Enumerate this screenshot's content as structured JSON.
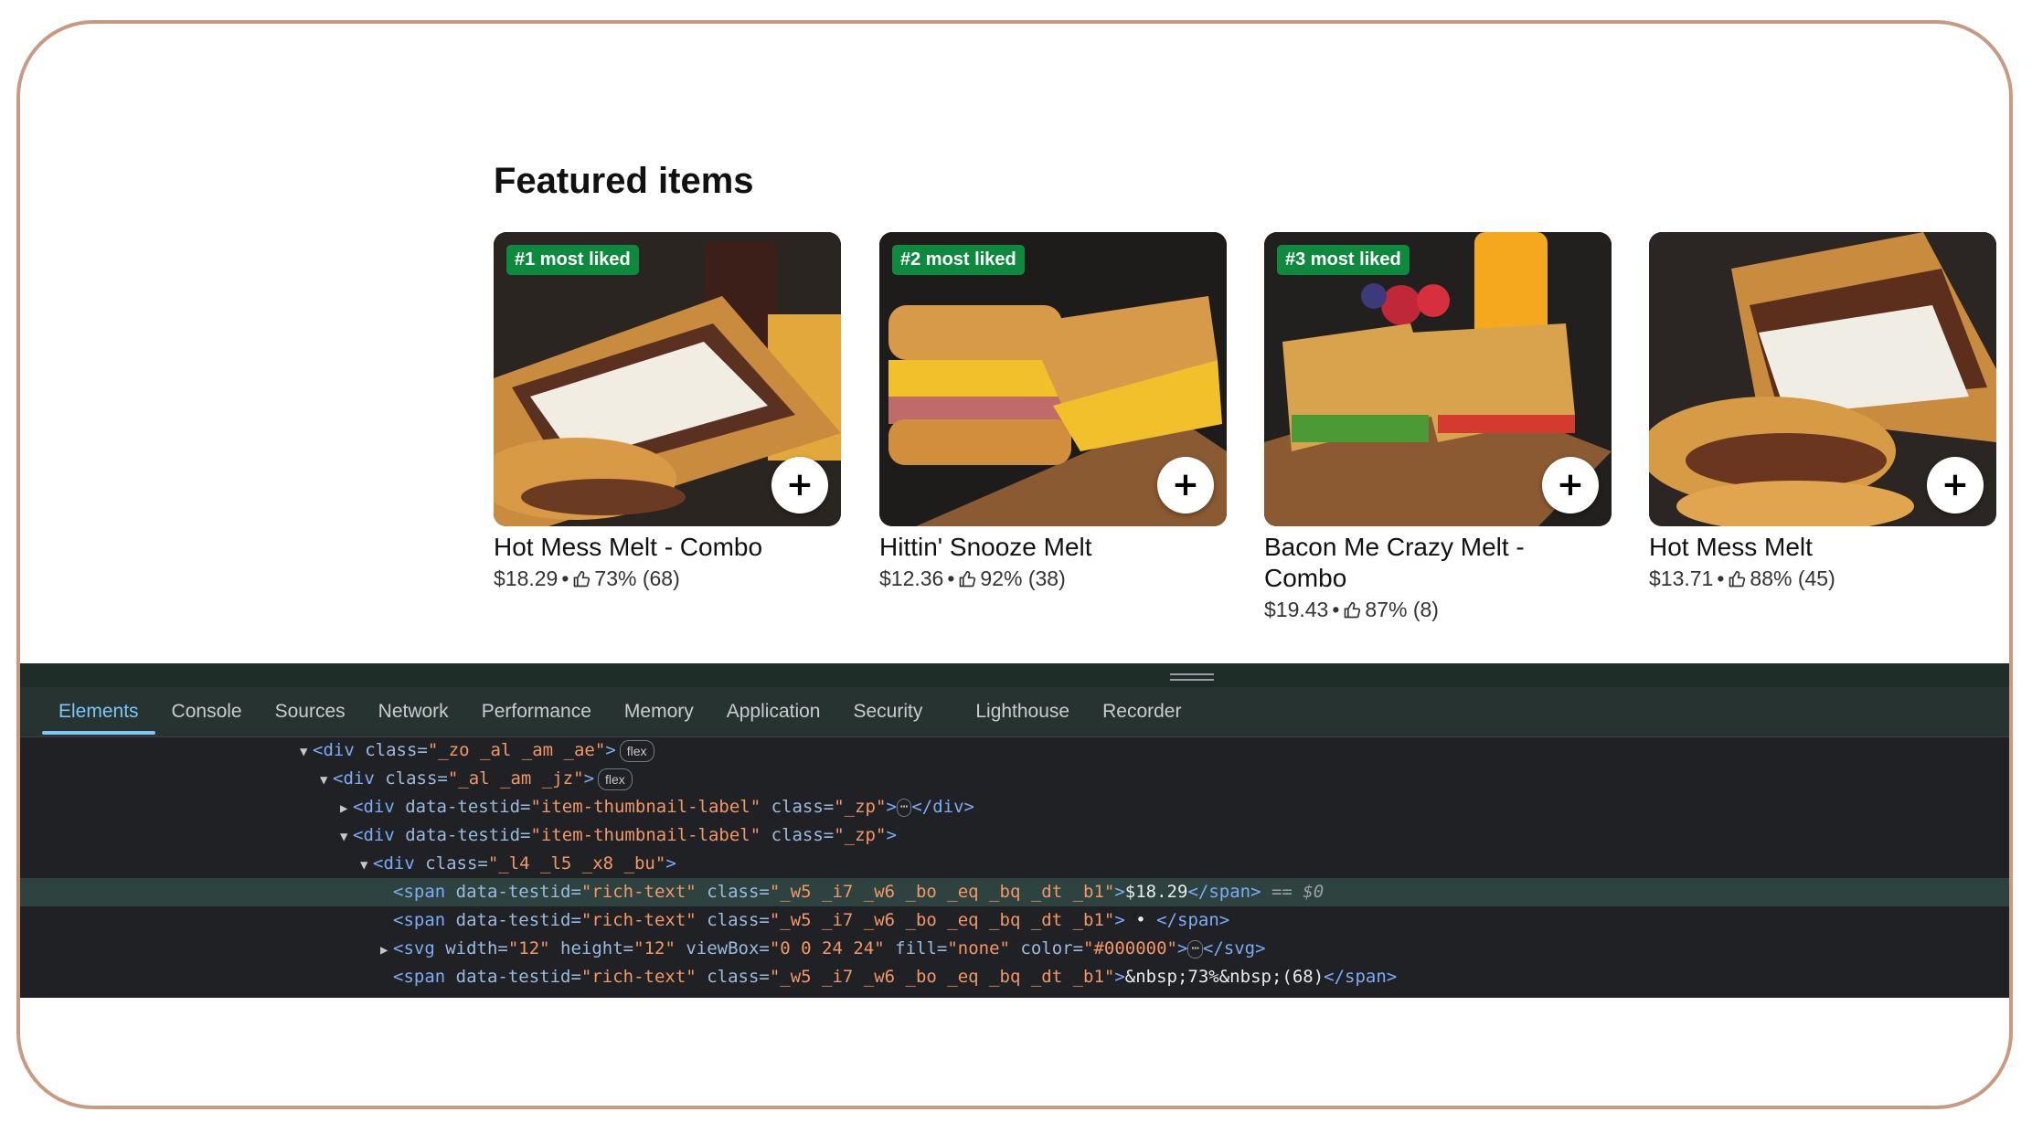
{
  "section": {
    "title": "Featured items"
  },
  "items": [
    {
      "badge": "#1 most liked",
      "name": "Hot Mess Melt - Combo",
      "price": "$18.29",
      "sep": "•",
      "rating": "73% (68)",
      "add": "+"
    },
    {
      "badge": "#2 most liked",
      "name": "Hittin' Snooze Melt",
      "price": "$12.36",
      "sep": "•",
      "rating": "92% (38)",
      "add": "+"
    },
    {
      "badge": "#3 most liked",
      "name": "Bacon Me Crazy Melt - Combo",
      "price": "$19.43",
      "sep": "•",
      "rating": "87% (8)",
      "add": "+"
    },
    {
      "badge": "",
      "name": "Hot Mess Melt",
      "price": "$13.71",
      "sep": "•",
      "rating": "88% (45)",
      "add": "+"
    }
  ],
  "devtools": {
    "tabs": [
      "Elements",
      "Console",
      "Sources",
      "Network",
      "Performance",
      "Memory",
      "Application",
      "Security",
      "Lighthouse",
      "Recorder"
    ],
    "active_tab": "Elements",
    "lines": {
      "l1_tag": "<div",
      "l1_attr": " class=",
      "l1_val": "\"_zo _al _am _ae\"",
      "l1_close": ">",
      "l1_pill": "flex",
      "l2_tag": "<div",
      "l2_attr": " class=",
      "l2_val": "\"_al _am _jz\"",
      "l2_close": ">",
      "l2_pill": "flex",
      "l3_tag": "<div",
      "l3_attr1": " data-testid=",
      "l3_val1": "\"item-thumbnail-label\"",
      "l3_attr2": " class=",
      "l3_val2": "\"_zp\"",
      "l3_close": ">",
      "l3_end": "</div>",
      "l4_tag": "<div",
      "l4_attr1": " data-testid=",
      "l4_val1": "\"item-thumbnail-label\"",
      "l4_attr2": " class=",
      "l4_val2": "\"_zp\"",
      "l4_close": ">",
      "l5_tag": "<div",
      "l5_attr": " class=",
      "l5_val": "\"_l4 _l5 _x8 _bu\"",
      "l5_close": ">",
      "l6_tag": "<span",
      "l6_attr1": " data-testid=",
      "l6_val1": "\"rich-text\"",
      "l6_attr2": " class=",
      "l6_val2": "\"_w5 _i7 _w6 _bo _eq _bq _dt _b1\"",
      "l6_close": ">",
      "l6_text": "$18.29",
      "l6_end": "</span>",
      "l6_eq": " == $0",
      "l7_tag": "<span",
      "l7_attr1": " data-testid=",
      "l7_val1": "\"rich-text\"",
      "l7_attr2": " class=",
      "l7_val2": "\"_w5 _i7 _w6 _bo _eq _bq _dt _b1\"",
      "l7_close": ">",
      "l7_text": " • ",
      "l7_end": "</span>",
      "l8_tag": "<svg",
      "l8_attr1": " width=",
      "l8_val1": "\"12\"",
      "l8_attr2": " height=",
      "l8_val2": "\"12\"",
      "l8_attr3": " viewBox=",
      "l8_val3": "\"0 0 24 24\"",
      "l8_attr4": " fill=",
      "l8_val4": "\"none\"",
      "l8_attr5": " color=",
      "l8_val5": "\"#000000\"",
      "l8_close": ">",
      "l8_end": "</svg>",
      "l9_tag": "<span",
      "l9_attr1": " data-testid=",
      "l9_val1": "\"rich-text\"",
      "l9_attr2": " class=",
      "l9_val2": "\"_w5 _i7 _w6 _bo _eq _bq _dt _b1\"",
      "l9_close": ">",
      "l9_text": "&nbsp;73%&nbsp;(68)",
      "l9_end": "</span>"
    },
    "ellipsis": "⋯"
  },
  "colors": {
    "badge": "#0e8a3e",
    "frame": "#c89a84",
    "devtools_bg": "#202124",
    "active_tab": "#7cc7f5"
  }
}
